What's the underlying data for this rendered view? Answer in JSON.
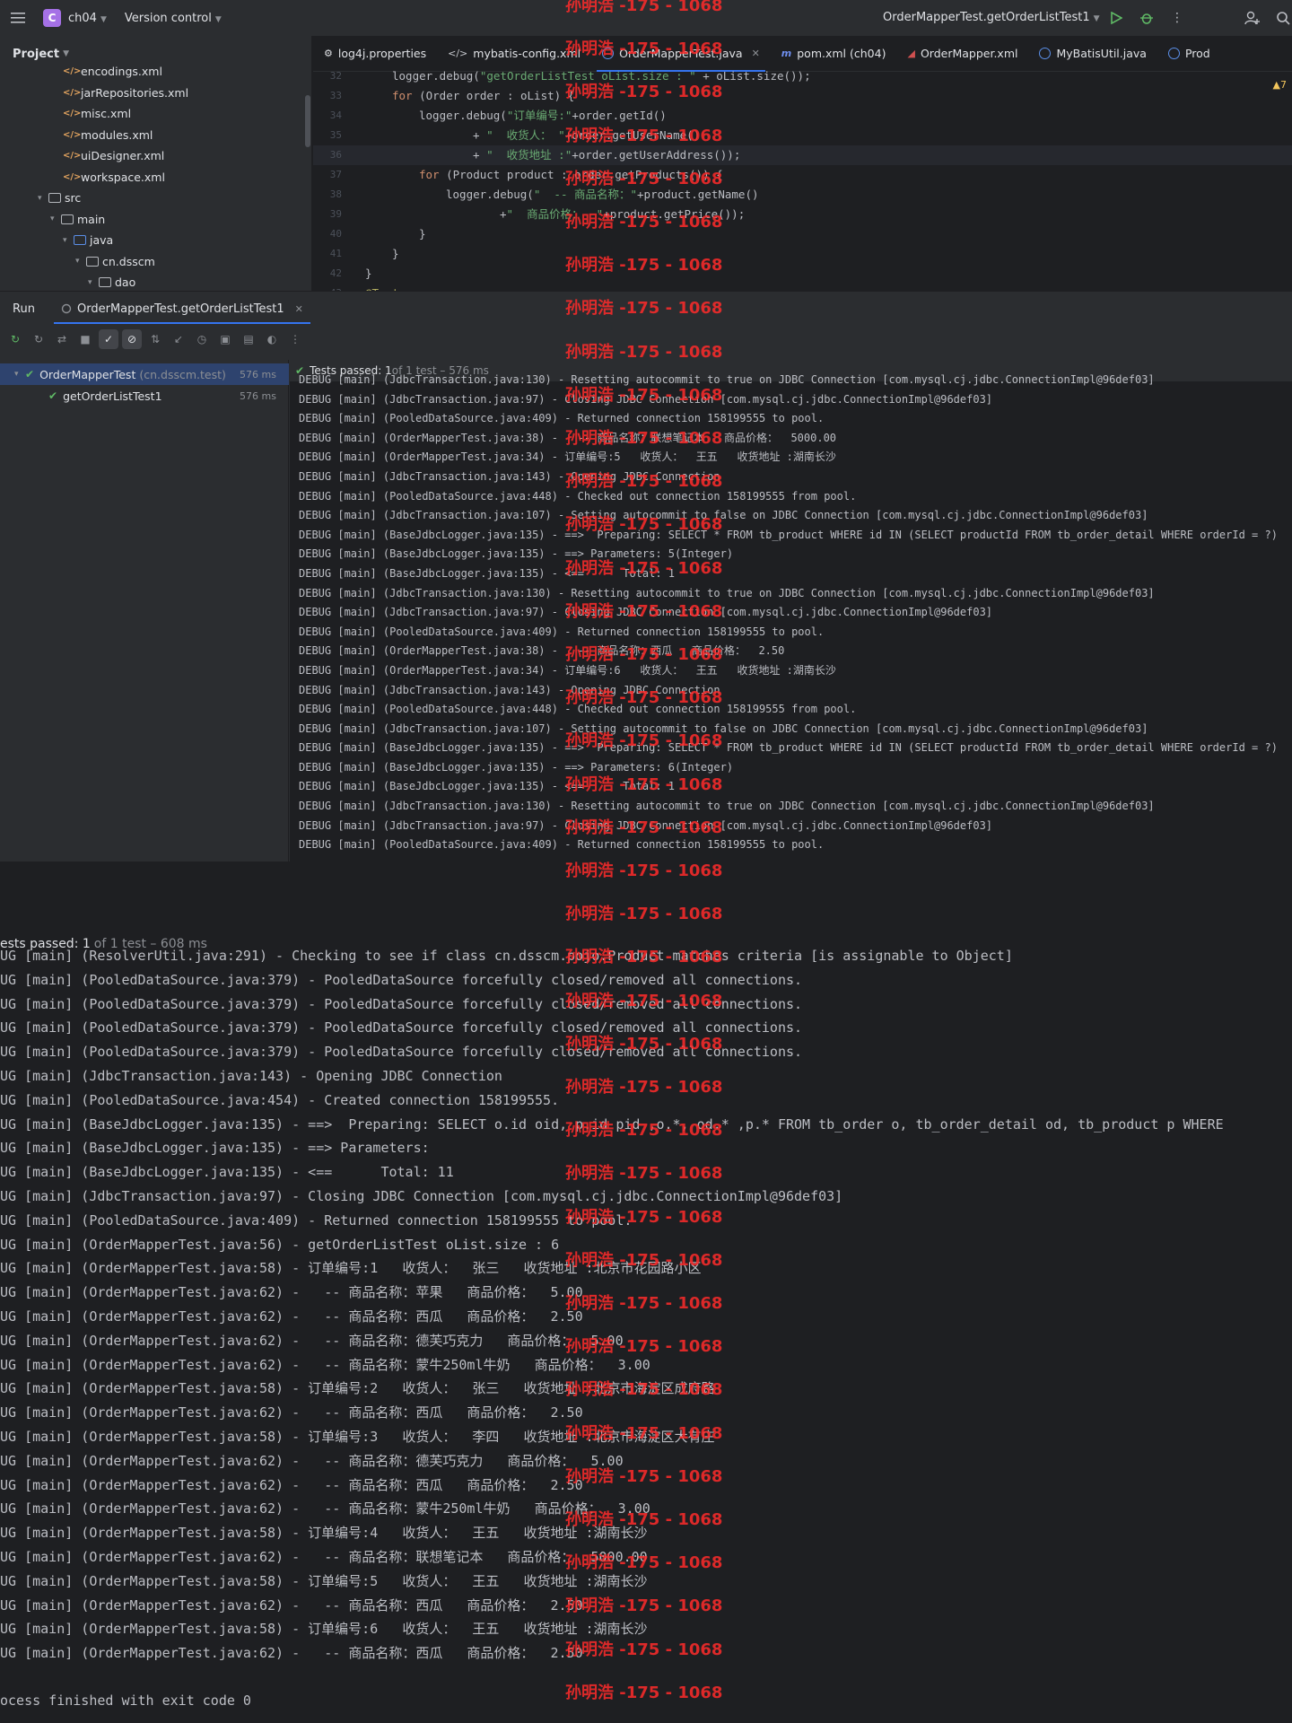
{
  "topbar": {
    "project_badge": "C",
    "project_name": "ch04",
    "version_control": "Version control",
    "run_config": "OrderMapperTest.getOrderListTest1"
  },
  "project_panel": {
    "title": "Project",
    "items": [
      {
        "label": "encodings.xml",
        "kind": "xml",
        "indent": 4
      },
      {
        "label": "jarRepositories.xml",
        "kind": "xml",
        "indent": 4
      },
      {
        "label": "misc.xml",
        "kind": "xml",
        "indent": 4
      },
      {
        "label": "modules.xml",
        "kind": "xml",
        "indent": 4
      },
      {
        "label": "uiDesigner.xml",
        "kind": "xml",
        "indent": 4
      },
      {
        "label": "workspace.xml",
        "kind": "xml",
        "indent": 4
      },
      {
        "label": "src",
        "kind": "folder",
        "indent": 2
      },
      {
        "label": "main",
        "kind": "folder",
        "indent": 3
      },
      {
        "label": "java",
        "kind": "folder-blue",
        "indent": 4
      },
      {
        "label": "cn.dsscm",
        "kind": "package",
        "indent": 5
      },
      {
        "label": "dao",
        "kind": "package",
        "indent": 6
      }
    ]
  },
  "editor": {
    "tabs": [
      {
        "label": "log4j.properties",
        "icon": "gear"
      },
      {
        "label": "mybatis-config.xml",
        "icon": "xml"
      },
      {
        "label": "OrderMapperTest.java",
        "icon": "class",
        "active": true
      },
      {
        "label": "pom.xml (ch04)",
        "icon": "maven"
      },
      {
        "label": "OrderMapper.xml",
        "icon": "mybatis"
      },
      {
        "label": "MyBatisUtil.java",
        "icon": "class"
      },
      {
        "label": "Prod",
        "icon": "class"
      }
    ],
    "warning": "▲7",
    "lines": [
      {
        "n": "32",
        "indent": 140,
        "parts": [
          [
            "",
            "logger.debug("
          ],
          [
            "st",
            "\"getOrderListTest oList.size : \""
          ],
          [
            "",
            " + oList.size());"
          ]
        ]
      },
      {
        "n": "33",
        "indent": 140,
        "parts": [
          [
            "kw",
            "for "
          ],
          [
            "",
            "(Order order : oList) {"
          ]
        ]
      },
      {
        "n": "34",
        "indent": 170,
        "parts": [
          [
            "",
            "logger.debug("
          ],
          [
            "st",
            "\"订单编号:\""
          ],
          [
            "",
            "+order.getId()"
          ]
        ]
      },
      {
        "n": "35",
        "indent": 230,
        "parts": [
          [
            "",
            "+ "
          ],
          [
            "st",
            "\"  收货人： \""
          ],
          [
            "",
            "+order.getUserName()"
          ]
        ]
      },
      {
        "n": "36",
        "indent": 230,
        "hl": true,
        "parts": [
          [
            "",
            "+ "
          ],
          [
            "st",
            "\"  收货地址 :\""
          ],
          [
            "",
            "+order.getUserAddress());"
          ]
        ]
      },
      {
        "n": "37",
        "indent": 170,
        "parts": [
          [
            "kw",
            "for "
          ],
          [
            "",
            "(Product product : order.getProducts()) {"
          ]
        ]
      },
      {
        "n": "38",
        "indent": 200,
        "parts": [
          [
            "",
            "logger.debug("
          ],
          [
            "st",
            "\"  -- 商品名称：\""
          ],
          [
            "",
            "+product.getName()"
          ]
        ]
      },
      {
        "n": "39",
        "indent": 260,
        "parts": [
          [
            "",
            "+"
          ],
          [
            "st",
            "\"  商品价格：  \""
          ],
          [
            "",
            "+product.getPrice());"
          ]
        ]
      },
      {
        "n": "40",
        "indent": 170,
        "parts": [
          [
            "",
            "}"
          ]
        ]
      },
      {
        "n": "41",
        "indent": 140,
        "parts": [
          [
            "",
            "}"
          ]
        ]
      },
      {
        "n": "42",
        "indent": 110,
        "parts": [
          [
            "",
            "}"
          ]
        ]
      },
      {
        "n": "43",
        "indent": 110,
        "parts": [
          [
            "an",
            "@Test"
          ]
        ]
      }
    ]
  },
  "run_panel": {
    "label": "Run",
    "tab": "OrderMapperTest.getOrderListTest1",
    "tree": [
      {
        "name": "OrderMapperTest",
        "pkg": "(cn.dsscm.test)",
        "ms": "576 ms",
        "selected": true
      },
      {
        "name": "getOrderListTest1",
        "pkg": "",
        "ms": "576 ms",
        "selected": false
      }
    ],
    "status_main": "Tests passed: 1",
    "status_rest": " of 1 test – 576 ms",
    "log": [
      "DEBUG [main] (JdbcTransaction.java:130) - Resetting autocommit to true on JDBC Connection [com.mysql.cj.jdbc.ConnectionImpl@96def03]",
      "DEBUG [main] (JdbcTransaction.java:97) - Closing JDBC Connection [com.mysql.cj.jdbc.ConnectionImpl@96def03]",
      "DEBUG [main] (PooledDataSource.java:409) - Returned connection 158199555 to pool.",
      "DEBUG [main] (OrderMapperTest.java:38) -   -- 商品名称：联想笔记本   商品价格：  5000.00",
      "DEBUG [main] (OrderMapperTest.java:34) - 订单编号:5   收货人：  王五   收货地址 :湖南长沙",
      "DEBUG [main] (JdbcTransaction.java:143) - Opening JDBC Connection",
      "DEBUG [main] (PooledDataSource.java:448) - Checked out connection 158199555 from pool.",
      "DEBUG [main] (JdbcTransaction.java:107) - Setting autocommit to false on JDBC Connection [com.mysql.cj.jdbc.ConnectionImpl@96def03]",
      "DEBUG [main] (BaseJdbcLogger.java:135) - ==>  Preparing: SELECT * FROM tb_product WHERE id IN (SELECT productId FROM tb_order_detail WHERE orderId = ?)",
      "DEBUG [main] (BaseJdbcLogger.java:135) - ==> Parameters: 5(Integer)",
      "DEBUG [main] (BaseJdbcLogger.java:135) - <==      Total: 1",
      "DEBUG [main] (JdbcTransaction.java:130) - Resetting autocommit to true on JDBC Connection [com.mysql.cj.jdbc.ConnectionImpl@96def03]",
      "DEBUG [main] (JdbcTransaction.java:97) - Closing JDBC Connection [com.mysql.cj.jdbc.ConnectionImpl@96def03]",
      "DEBUG [main] (PooledDataSource.java:409) - Returned connection 158199555 to pool.",
      "DEBUG [main] (OrderMapperTest.java:38) -   -- 商品名称：西瓜   商品价格：  2.50",
      "DEBUG [main] (OrderMapperTest.java:34) - 订单编号:6   收货人：  王五   收货地址 :湖南长沙",
      "DEBUG [main] (JdbcTransaction.java:143) - Opening JDBC Connection",
      "DEBUG [main] (PooledDataSource.java:448) - Checked out connection 158199555 from pool.",
      "DEBUG [main] (JdbcTransaction.java:107) - Setting autocommit to false on JDBC Connection [com.mysql.cj.jdbc.ConnectionImpl@96def03]",
      "DEBUG [main] (BaseJdbcLogger.java:135) - ==>  Preparing: SELECT * FROM tb_product WHERE id IN (SELECT productId FROM tb_order_detail WHERE orderId = ?)",
      "DEBUG [main] (BaseJdbcLogger.java:135) - ==> Parameters: 6(Integer)",
      "DEBUG [main] (BaseJdbcLogger.java:135) - <==      Total: 1",
      "DEBUG [main] (JdbcTransaction.java:130) - Resetting autocommit to true on JDBC Connection [com.mysql.cj.jdbc.ConnectionImpl@96def03]",
      "DEBUG [main] (JdbcTransaction.java:97) - Closing JDBC Connection [com.mysql.cj.jdbc.ConnectionImpl@96def03]",
      "DEBUG [main] (PooledDataSource.java:409) - Returned connection 158199555 to pool."
    ]
  },
  "lower": {
    "status_main": "ests passed: 1",
    "status_rest": " of 1 test – 608 ms",
    "log": [
      "UG [main] (ResolverUtil.java:291) - Checking to see if class cn.dsscm.pojo.Product matches criteria [is assignable to Object]",
      "UG [main] (PooledDataSource.java:379) - PooledDataSource forcefully closed/removed all connections.",
      "UG [main] (PooledDataSource.java:379) - PooledDataSource forcefully closed/removed all connections.",
      "UG [main] (PooledDataSource.java:379) - PooledDataSource forcefully closed/removed all connections.",
      "UG [main] (PooledDataSource.java:379) - PooledDataSource forcefully closed/removed all connections.",
      "UG [main] (JdbcTransaction.java:143) - Opening JDBC Connection",
      "UG [main] (PooledDataSource.java:454) - Created connection 158199555.",
      "UG [main] (BaseJdbcLogger.java:135) - ==>  Preparing: SELECT o.id oid, p.id pid ,o.*, od.* ,p.* FROM tb_order o, tb_order_detail od, tb_product p WHERE",
      "UG [main] (BaseJdbcLogger.java:135) - ==> Parameters: ",
      "UG [main] (BaseJdbcLogger.java:135) - <==      Total: 11",
      "UG [main] (JdbcTransaction.java:97) - Closing JDBC Connection [com.mysql.cj.jdbc.ConnectionImpl@96def03]",
      "UG [main] (PooledDataSource.java:409) - Returned connection 158199555 to pool.",
      "UG [main] (OrderMapperTest.java:56) - getOrderListTest oList.size : 6",
      "UG [main] (OrderMapperTest.java:58) - 订单编号:1   收货人：  张三   收货地址 :北京市花园路小区",
      "UG [main] (OrderMapperTest.java:62) -   -- 商品名称：苹果   商品价格：  5.00",
      "UG [main] (OrderMapperTest.java:62) -   -- 商品名称：西瓜   商品价格：  2.50",
      "UG [main] (OrderMapperTest.java:62) -   -- 商品名称：德芙巧克力   商品价格：  5.00",
      "UG [main] (OrderMapperTest.java:62) -   -- 商品名称：蒙牛250ml牛奶   商品价格：  3.00",
      "UG [main] (OrderMapperTest.java:58) - 订单编号:2   收货人：  张三   收货地址 :北京市海淀区成府路",
      "UG [main] (OrderMapperTest.java:62) -   -- 商品名称：西瓜   商品价格：  2.50",
      "UG [main] (OrderMapperTest.java:58) - 订单编号:3   收货人：  李四   收货地址 :北京市海淀区大有庄",
      "UG [main] (OrderMapperTest.java:62) -   -- 商品名称：德芙巧克力   商品价格：  5.00",
      "UG [main] (OrderMapperTest.java:62) -   -- 商品名称：西瓜   商品价格：  2.50",
      "UG [main] (OrderMapperTest.java:62) -   -- 商品名称：蒙牛250ml牛奶   商品价格：  3.00",
      "UG [main] (OrderMapperTest.java:58) - 订单编号:4   收货人：  王五   收货地址 :湖南长沙",
      "UG [main] (OrderMapperTest.java:62) -   -- 商品名称：联想笔记本   商品价格：  5000.00",
      "UG [main] (OrderMapperTest.java:58) - 订单编号:5   收货人：  王五   收货地址 :湖南长沙",
      "UG [main] (OrderMapperTest.java:62) -   -- 商品名称：西瓜   商品价格：  2.50",
      "UG [main] (OrderMapperTest.java:58) - 订单编号:6   收货人：  王五   收货地址 :湖南长沙",
      "UG [main] (OrderMapperTest.java:62) -   -- 商品名称：西瓜   商品价格：  2.50"
    ],
    "exit": "ocess finished with exit code 0"
  },
  "watermark": "孙明浩 -175 - 1068",
  "colors": {
    "accent": "#3574f0",
    "pass": "#5fb865",
    "watermark": "#ff2b2b"
  }
}
